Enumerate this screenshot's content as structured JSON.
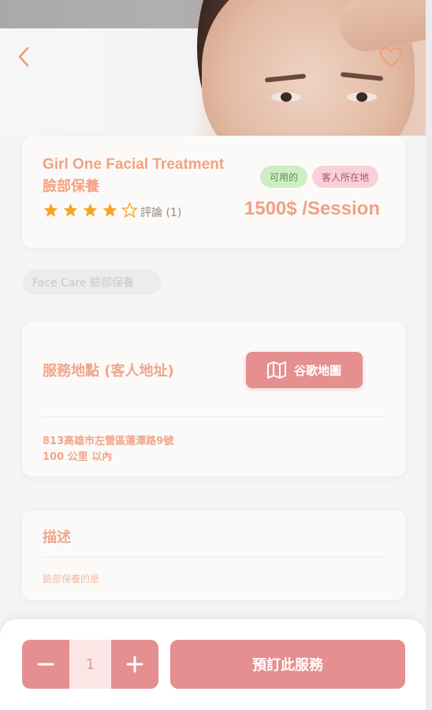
{
  "header": {
    "back_icon": "chevron-left-icon",
    "favorite_icon": "heart-outline-icon"
  },
  "service": {
    "title_en": "Girl One Facial Treatment",
    "title_zh": "臉部保養",
    "badges": [
      "可用的",
      "客人所在地"
    ],
    "rating": 4,
    "rating_max": 5,
    "reviews_label": "評論 (1)",
    "price": "1500$ /Session"
  },
  "category_chip": "Face Care 臉部保養",
  "location": {
    "title": "服務地點 (客人地址)",
    "map_button_label": "谷歌地圖",
    "map_icon": "map-icon",
    "address": "813高雄市左營區蓮潭路9號",
    "distance": "100 公里 以內"
  },
  "description": {
    "title": "描述",
    "text": "臉部保養的是"
  },
  "booking": {
    "quantity": "1",
    "decrement_icon": "minus-icon",
    "increment_icon": "plus-icon",
    "book_label": "預訂此服務"
  },
  "colors": {
    "accent": "#e58f90",
    "title_text": "#f4a27f",
    "star": "#f5a623",
    "badge_available_bg": "#cdeec4",
    "badge_location_bg": "#f8d0da"
  }
}
